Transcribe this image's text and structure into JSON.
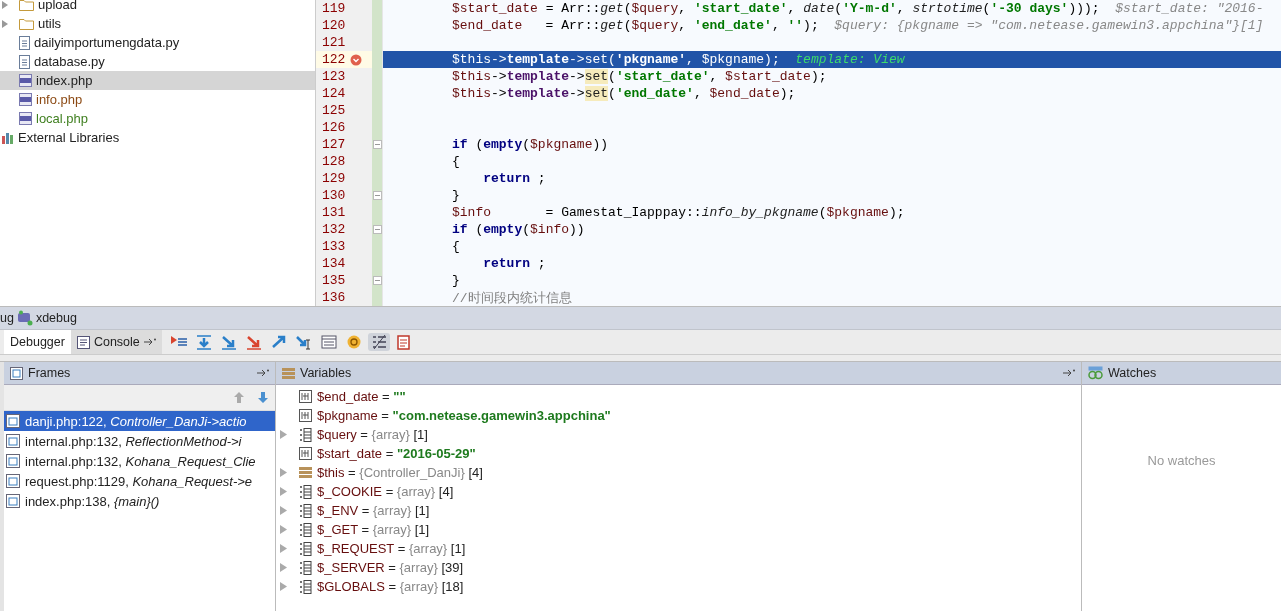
{
  "project_tree": [
    {
      "label": "upload",
      "kind": "folder",
      "expanded": false,
      "selected": false
    },
    {
      "label": "utils",
      "kind": "folder",
      "expanded": false,
      "selected": false
    },
    {
      "label": "dailyimportumengdata.py",
      "kind": "file",
      "selected": false
    },
    {
      "label": "database.py",
      "kind": "file",
      "selected": false
    },
    {
      "label": "index.php",
      "kind": "php",
      "selected": true
    },
    {
      "label": "info.php",
      "kind": "php",
      "selected": false,
      "color": "#8c4a14"
    },
    {
      "label": "local.php",
      "kind": "php",
      "selected": false,
      "color": "#3f7f1f"
    },
    {
      "label": "External Libraries",
      "kind": "library",
      "selected": false
    }
  ],
  "editor": {
    "lines": [
      {
        "number": "119",
        "current": false,
        "breakpoint": false,
        "fold": false,
        "tokens": [
          {
            "text": "$start_date",
            "kind": "var"
          },
          {
            "text": " = Arr::",
            "kind": "plain"
          },
          {
            "text": "get",
            "kind": "italic"
          },
          {
            "text": "(",
            "kind": "plain"
          },
          {
            "text": "$query",
            "kind": "var"
          },
          {
            "text": ", ",
            "kind": "plain"
          },
          {
            "text": "'start_date'",
            "kind": "str"
          },
          {
            "text": ", ",
            "kind": "plain"
          },
          {
            "text": "date",
            "kind": "italic"
          },
          {
            "text": "(",
            "kind": "plain"
          },
          {
            "text": "'Y-m-d'",
            "kind": "str"
          },
          {
            "text": ", ",
            "kind": "plain"
          },
          {
            "text": "strtotime",
            "kind": "italic"
          },
          {
            "text": "(",
            "kind": "plain"
          },
          {
            "text": "'-30 days'",
            "kind": "str"
          },
          {
            "text": ")));",
            "kind": "plain"
          },
          {
            "text": "  $start_date: \"2016-",
            "kind": "hint"
          }
        ]
      },
      {
        "number": "120",
        "current": false,
        "breakpoint": false,
        "fold": false,
        "tokens": [
          {
            "text": "$end_date",
            "kind": "var"
          },
          {
            "text": "   = Arr::",
            "kind": "plain"
          },
          {
            "text": "get",
            "kind": "italic"
          },
          {
            "text": "(",
            "kind": "plain"
          },
          {
            "text": "$query",
            "kind": "var"
          },
          {
            "text": ", ",
            "kind": "plain"
          },
          {
            "text": "'end_date'",
            "kind": "str"
          },
          {
            "text": ", ",
            "kind": "plain"
          },
          {
            "text": "''",
            "kind": "str"
          },
          {
            "text": ");",
            "kind": "plain"
          },
          {
            "text": "  $query: {pkgname => \"com.netease.gamewin3.appchina\"}[1]",
            "kind": "hint"
          }
        ]
      },
      {
        "number": "121",
        "current": false,
        "breakpoint": false,
        "fold": false
      },
      {
        "number": "122",
        "current": true,
        "breakpoint": true,
        "fold": false,
        "tokens": [
          {
            "text": "$this",
            "kind": "var"
          },
          {
            "text": "->",
            "kind": "plain"
          },
          {
            "text": "template",
            "kind": "member"
          },
          {
            "text": "->set(",
            "kind": "plain"
          },
          {
            "text": "'pkgname'",
            "kind": "str"
          },
          {
            "text": ", ",
            "kind": "plain"
          },
          {
            "text": "$pkgname",
            "kind": "var"
          },
          {
            "text": ");",
            "kind": "plain"
          },
          {
            "text": "  template: View",
            "kind": "exechint"
          }
        ]
      },
      {
        "number": "123",
        "current": false,
        "breakpoint": false,
        "fold": false,
        "tokens": [
          {
            "text": "$this",
            "kind": "var"
          },
          {
            "text": "->",
            "kind": "plain"
          },
          {
            "text": "template",
            "kind": "member"
          },
          {
            "text": "->",
            "kind": "plain"
          },
          {
            "text": "set",
            "kind": "usage"
          },
          {
            "text": "(",
            "kind": "plain"
          },
          {
            "text": "'start_date'",
            "kind": "str"
          },
          {
            "text": ", ",
            "kind": "plain"
          },
          {
            "text": "$start_date",
            "kind": "var"
          },
          {
            "text": ");",
            "kind": "plain"
          }
        ]
      },
      {
        "number": "124",
        "current": false,
        "breakpoint": false,
        "fold": false,
        "tokens": [
          {
            "text": "$this",
            "kind": "var"
          },
          {
            "text": "->",
            "kind": "plain"
          },
          {
            "text": "template",
            "kind": "member"
          },
          {
            "text": "->",
            "kind": "plain"
          },
          {
            "text": "set",
            "kind": "usage"
          },
          {
            "text": "(",
            "kind": "plain"
          },
          {
            "text": "'end_date'",
            "kind": "str"
          },
          {
            "text": ", ",
            "kind": "plain"
          },
          {
            "text": "$end_date",
            "kind": "var"
          },
          {
            "text": ");",
            "kind": "plain"
          }
        ]
      },
      {
        "number": "125",
        "current": false,
        "breakpoint": false,
        "fold": false
      },
      {
        "number": "126",
        "current": false,
        "breakpoint": false,
        "fold": false
      },
      {
        "number": "127",
        "current": false,
        "breakpoint": false,
        "fold": true,
        "tokens": [
          {
            "text": "if",
            "kind": "kw"
          },
          {
            "text": " (",
            "kind": "plain"
          },
          {
            "text": "empty",
            "kind": "kw"
          },
          {
            "text": "(",
            "kind": "plain"
          },
          {
            "text": "$pkgname",
            "kind": "var"
          },
          {
            "text": "))",
            "kind": "plain"
          }
        ]
      },
      {
        "number": "128",
        "current": false,
        "breakpoint": false,
        "fold": false,
        "tokens": [
          {
            "text": "{",
            "kind": "plain"
          }
        ]
      },
      {
        "number": "129",
        "current": false,
        "breakpoint": false,
        "fold": false,
        "tokens": [
          {
            "text": "    return",
            "kind": "kw"
          },
          {
            "text": " ;",
            "kind": "plain"
          }
        ]
      },
      {
        "number": "130",
        "current": false,
        "breakpoint": false,
        "fold": true,
        "tokens": [
          {
            "text": "}",
            "kind": "plain"
          }
        ]
      },
      {
        "number": "131",
        "current": false,
        "breakpoint": false,
        "fold": false,
        "tokens": [
          {
            "text": "$info",
            "kind": "var"
          },
          {
            "text": "       = Gamestat_Iapppay::",
            "kind": "plain"
          },
          {
            "text": "info_by_pkgname",
            "kind": "italic"
          },
          {
            "text": "(",
            "kind": "plain"
          },
          {
            "text": "$pkgname",
            "kind": "var"
          },
          {
            "text": ");",
            "kind": "plain"
          }
        ]
      },
      {
        "number": "132",
        "current": false,
        "breakpoint": false,
        "fold": true,
        "tokens": [
          {
            "text": "if",
            "kind": "kw"
          },
          {
            "text": " (",
            "kind": "plain"
          },
          {
            "text": "empty",
            "kind": "kw"
          },
          {
            "text": "(",
            "kind": "plain"
          },
          {
            "text": "$info",
            "kind": "var"
          },
          {
            "text": "))",
            "kind": "plain"
          }
        ]
      },
      {
        "number": "133",
        "current": false,
        "breakpoint": false,
        "fold": false,
        "tokens": [
          {
            "text": "{",
            "kind": "plain"
          }
        ]
      },
      {
        "number": "134",
        "current": false,
        "breakpoint": false,
        "fold": false,
        "tokens": [
          {
            "text": "    return",
            "kind": "kw"
          },
          {
            "text": " ;",
            "kind": "plain"
          }
        ]
      },
      {
        "number": "135",
        "current": false,
        "breakpoint": false,
        "fold": true,
        "tokens": [
          {
            "text": "}",
            "kind": "plain"
          }
        ]
      },
      {
        "number": "136",
        "current": false,
        "breakpoint": false,
        "fold": false,
        "tokens": [
          {
            "text": "//时间段内统计信息",
            "kind": "comment"
          }
        ]
      }
    ]
  },
  "debug_window": {
    "title_prefix": "ug",
    "title": "xdebug",
    "tabs": [
      {
        "label": "Debugger",
        "selected": true
      },
      {
        "label": "Console",
        "selected": false
      }
    ],
    "toolbar": [
      {
        "kind": "show-execution-point"
      },
      {
        "kind": "step-over"
      },
      {
        "kind": "step-into"
      },
      {
        "kind": "force-step-into"
      },
      {
        "kind": "step-out"
      },
      {
        "kind": "run-to-cursor"
      },
      {
        "kind": "evaluate"
      },
      {
        "kind": "watch"
      },
      {
        "kind": "toggle-values"
      },
      {
        "kind": "clipboard"
      }
    ],
    "frames": {
      "title": "Frames",
      "items": [
        {
          "file": "danji.php:122, ",
          "call": "Controller_DanJi->actio",
          "selected": true
        },
        {
          "file": "internal.php:132, ",
          "call": "ReflectionMethod->i",
          "selected": false
        },
        {
          "file": "internal.php:132, ",
          "call": "Kohana_Request_Clie",
          "selected": false
        },
        {
          "file": "request.php:1129, ",
          "call": "Kohana_Request->e",
          "selected": false
        },
        {
          "file": "index.php:138, ",
          "call": "{main}()",
          "selected": false
        }
      ]
    },
    "variables": {
      "title": "Variables",
      "items": [
        {
          "name": "$end_date",
          "op": "=",
          "kind": "string",
          "value": "\"\""
        },
        {
          "name": "$pkgname",
          "op": "=",
          "kind": "string",
          "value": "\"com.netease.gamewin3.appchina\""
        },
        {
          "name": "$query",
          "op": "=",
          "kind": "array",
          "value": "{array}",
          "count": "[1]",
          "expanded": false
        },
        {
          "name": "$start_date",
          "op": "=",
          "kind": "string",
          "value": "\"2016-05-29\""
        },
        {
          "name": "$this",
          "op": "=",
          "kind": "object",
          "value": "{Controller_DanJi}",
          "count": "[4]",
          "expanded": false
        },
        {
          "name": "$_COOKIE",
          "op": "=",
          "kind": "array",
          "value": "{array}",
          "count": "[4]",
          "expanded": false
        },
        {
          "name": "$_ENV",
          "op": "=",
          "kind": "array",
          "value": "{array}",
          "count": "[1]",
          "expanded": false
        },
        {
          "name": "$_GET",
          "op": "=",
          "kind": "array",
          "value": "{array}",
          "count": "[1]",
          "expanded": false
        },
        {
          "name": "$_REQUEST",
          "op": "=",
          "kind": "array",
          "value": "{array}",
          "count": "[1]",
          "expanded": false
        },
        {
          "name": "$_SERVER",
          "op": "=",
          "kind": "array",
          "value": "{array}",
          "count": "[39]",
          "expanded": false
        },
        {
          "name": "$GLOBALS",
          "op": "=",
          "kind": "array",
          "value": "{array}",
          "count": "[18]",
          "expanded": false
        }
      ]
    },
    "watches": {
      "title": "Watches",
      "empty_text": "No watches"
    }
  }
}
